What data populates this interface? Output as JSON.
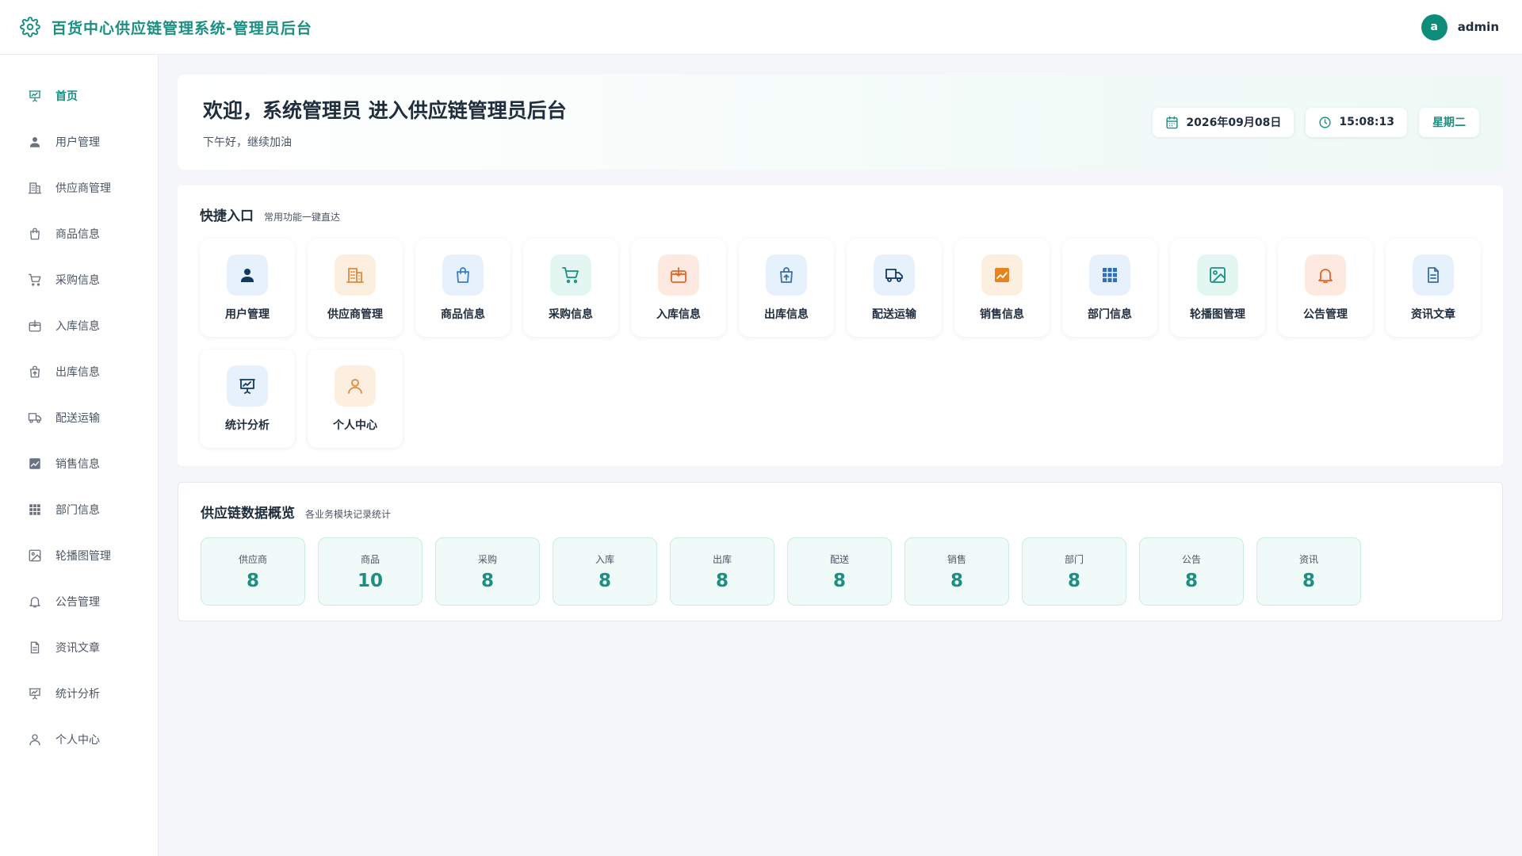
{
  "app": {
    "title": "百货中心供应链管理系统-管理员后台"
  },
  "user": {
    "avatar_letter": "a",
    "name": "admin"
  },
  "colors": {
    "accent": "#1a8f82",
    "avatar": "#0e8c7a",
    "background": "#f4f6f9"
  },
  "sidebar": {
    "items": [
      {
        "label": "首页",
        "icon": "presentation-chart-icon",
        "active": true
      },
      {
        "label": "用户管理",
        "icon": "user-icon"
      },
      {
        "label": "供应商管理",
        "icon": "building-icon"
      },
      {
        "label": "商品信息",
        "icon": "shopping-bag-icon"
      },
      {
        "label": "采购信息",
        "icon": "cart-icon"
      },
      {
        "label": "入库信息",
        "icon": "box-in-icon"
      },
      {
        "label": "出库信息",
        "icon": "bag-out-icon"
      },
      {
        "label": "配送运输",
        "icon": "truck-icon"
      },
      {
        "label": "销售信息",
        "icon": "trend-chart-icon"
      },
      {
        "label": "部门信息",
        "icon": "grid-icon"
      },
      {
        "label": "轮播图管理",
        "icon": "image-icon"
      },
      {
        "label": "公告管理",
        "icon": "bell-icon"
      },
      {
        "label": "资讯文章",
        "icon": "document-icon"
      },
      {
        "label": "统计分析",
        "icon": "presentation-chart-icon"
      },
      {
        "label": "个人中心",
        "icon": "user-outline-icon"
      }
    ]
  },
  "welcome": {
    "title": "欢迎，系统管理员 进入供应链管理员后台",
    "subtitle": "下午好，继续加油",
    "date": "2026年09月08日",
    "time": "15:08:13",
    "weekday": "星期二"
  },
  "quick": {
    "title": "快捷入口",
    "subtitle": "常用功能一键直达",
    "items": [
      {
        "label": "用户管理",
        "icon": "user-icon"
      },
      {
        "label": "供应商管理",
        "icon": "building-icon"
      },
      {
        "label": "商品信息",
        "icon": "shopping-bag-icon"
      },
      {
        "label": "采购信息",
        "icon": "cart-icon"
      },
      {
        "label": "入库信息",
        "icon": "box-in-icon"
      },
      {
        "label": "出库信息",
        "icon": "bag-out-icon"
      },
      {
        "label": "配送运输",
        "icon": "truck-icon"
      },
      {
        "label": "销售信息",
        "icon": "trend-chart-icon"
      },
      {
        "label": "部门信息",
        "icon": "grid-icon"
      },
      {
        "label": "轮播图管理",
        "icon": "image-icon"
      },
      {
        "label": "公告管理",
        "icon": "bell-icon"
      },
      {
        "label": "资讯文章",
        "icon": "document-icon"
      },
      {
        "label": "统计分析",
        "icon": "presentation-chart-icon"
      },
      {
        "label": "个人中心",
        "icon": "user-outline-icon"
      }
    ]
  },
  "overview": {
    "title": "供应链数据概览",
    "subtitle": "各业务模块记录统计",
    "stats": [
      {
        "label": "供应商",
        "value": "8"
      },
      {
        "label": "商品",
        "value": "10"
      },
      {
        "label": "采购",
        "value": "8"
      },
      {
        "label": "入库",
        "value": "8"
      },
      {
        "label": "出库",
        "value": "8"
      },
      {
        "label": "配送",
        "value": "8"
      },
      {
        "label": "销售",
        "value": "8"
      },
      {
        "label": "部门",
        "value": "8"
      },
      {
        "label": "公告",
        "value": "8"
      },
      {
        "label": "资讯",
        "value": "8"
      }
    ]
  }
}
